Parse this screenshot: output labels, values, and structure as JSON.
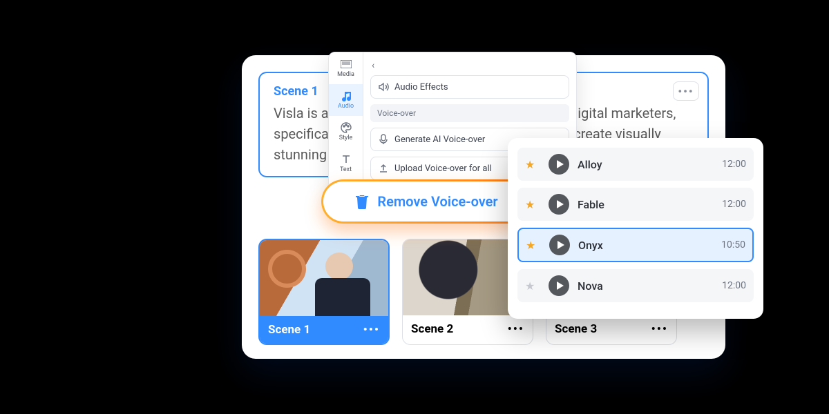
{
  "scene_panel": {
    "title": "Scene 1",
    "body": "Visla is a tool designed for content creators and digital marketers, specifically utilizing the power of AI to help them create visually stunning and high-converting videos without complexity."
  },
  "thumbs": [
    {
      "label": "Scene 1",
      "active": true
    },
    {
      "label": "Scene 2",
      "active": false
    },
    {
      "label": "Scene 3",
      "active": false
    }
  ],
  "tool_tabs": {
    "media": "Media",
    "audio": "Audio",
    "style": "Style",
    "text": "Text"
  },
  "audio_panel": {
    "audio_effects": "Audio Effects",
    "section": "Voice-over",
    "generate": "Generate AI Voice-over",
    "upload": "Upload Voice-over for all"
  },
  "remove_button": "Remove Voice-over",
  "voices": [
    {
      "name": "Alloy",
      "time": "12:00",
      "starred": true,
      "selected": false
    },
    {
      "name": "Fable",
      "time": "12:00",
      "starred": true,
      "selected": false
    },
    {
      "name": "Onyx",
      "time": "10:50",
      "starred": true,
      "selected": true
    },
    {
      "name": "Nova",
      "time": "12:00",
      "starred": false,
      "selected": false
    }
  ]
}
